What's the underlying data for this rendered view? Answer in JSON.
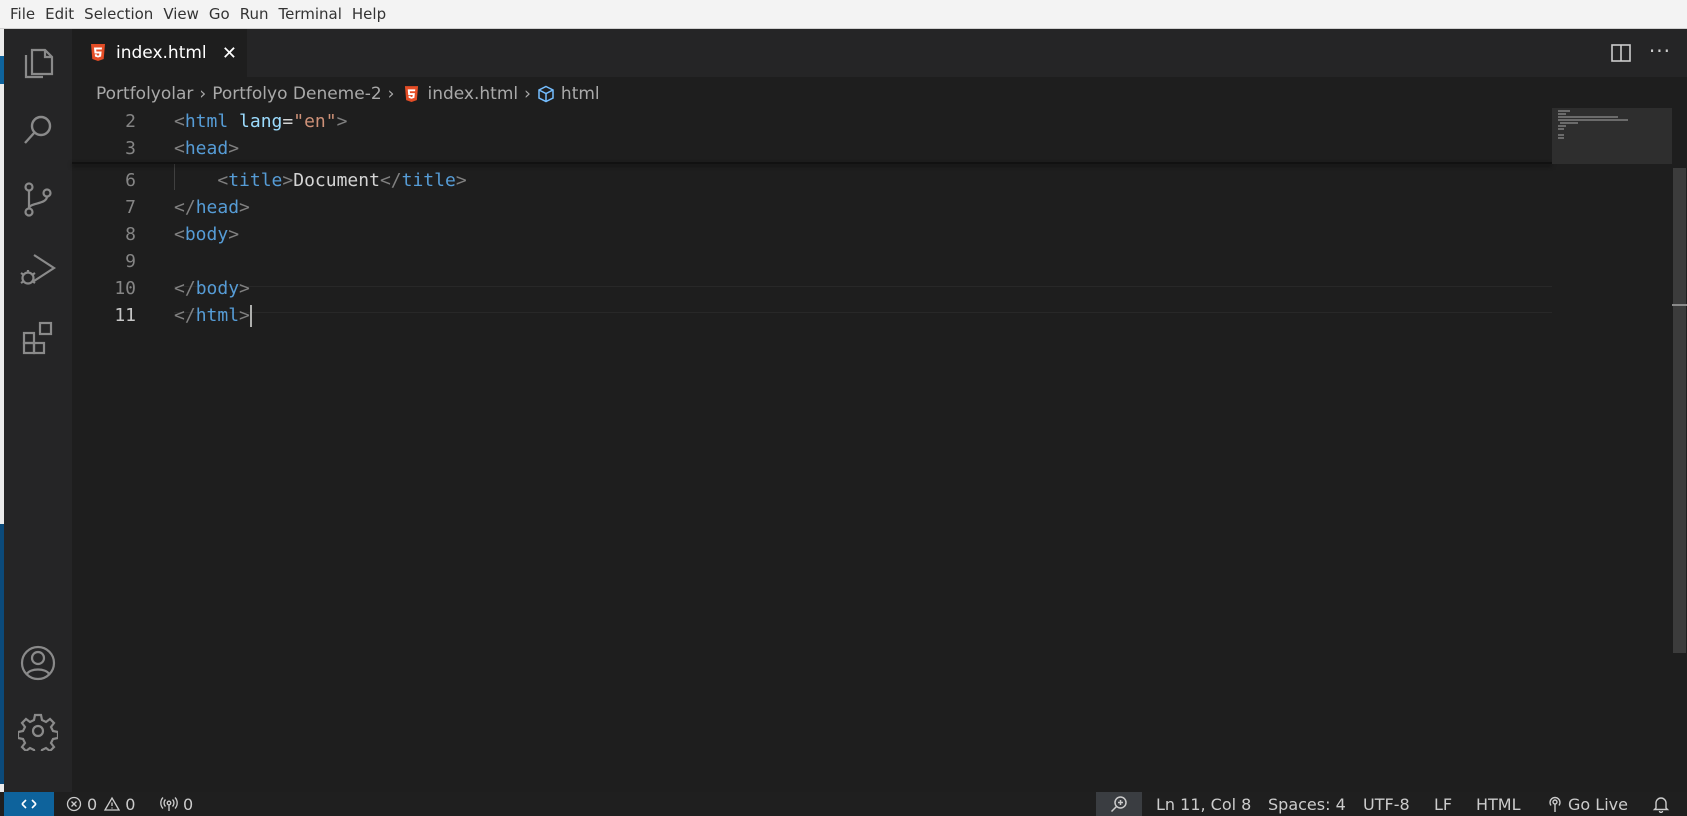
{
  "menu": [
    "File",
    "Edit",
    "Selection",
    "View",
    "Go",
    "Run",
    "Terminal",
    "Help"
  ],
  "activity_bar": [
    "explorer-icon",
    "search-icon",
    "source-control-icon",
    "run-debug-icon",
    "extensions-icon",
    "account-icon",
    "settings-gear-icon"
  ],
  "tab": {
    "label": "index.html",
    "close": "✕",
    "icon": "html5-icon"
  },
  "editor_actions": {
    "more": "···"
  },
  "breadcrumb": {
    "items": [
      "Portfolyolar",
      "Portfolyo Deneme-2",
      "index.html",
      "html"
    ],
    "separator": "›"
  },
  "editor": {
    "lines": [
      {
        "num": "2",
        "tokens": [
          [
            "<",
            "punc"
          ],
          [
            "html",
            "tag"
          ],
          [
            " ",
            "text"
          ],
          [
            "lang",
            "attr"
          ],
          [
            "=",
            "text"
          ],
          [
            "\"en\"",
            "str"
          ],
          [
            ">",
            "punc"
          ]
        ]
      },
      {
        "num": "3",
        "tokens": [
          [
            "<",
            "punc"
          ],
          [
            "head",
            "tag"
          ],
          [
            ">",
            "punc"
          ]
        ]
      },
      {
        "num": "6",
        "tokens": [
          [
            "    ",
            "text"
          ],
          [
            "<",
            "punc"
          ],
          [
            "title",
            "tag"
          ],
          [
            ">",
            "punc"
          ],
          [
            "Document",
            "text"
          ],
          [
            "</",
            "punc"
          ],
          [
            "title",
            "tag"
          ],
          [
            ">",
            "punc"
          ]
        ]
      },
      {
        "num": "7",
        "tokens": [
          [
            "</",
            "punc"
          ],
          [
            "head",
            "tag"
          ],
          [
            ">",
            "punc"
          ]
        ]
      },
      {
        "num": "8",
        "tokens": [
          [
            "<",
            "punc"
          ],
          [
            "body",
            "tag"
          ],
          [
            ">",
            "punc"
          ]
        ]
      },
      {
        "num": "9",
        "tokens": []
      },
      {
        "num": "10",
        "tokens": [
          [
            "</",
            "punc"
          ],
          [
            "body",
            "tag"
          ],
          [
            ">",
            "punc"
          ]
        ]
      },
      {
        "num": "11",
        "tokens": [
          [
            "</",
            "punc"
          ],
          [
            "html",
            "tag"
          ],
          [
            ">",
            "punc"
          ]
        ]
      }
    ],
    "active_line": "11"
  },
  "status": {
    "errors": "0",
    "warnings": "0",
    "ports": "0",
    "position": "Ln 11, Col 8",
    "spaces": "Spaces: 4",
    "encoding": "UTF-8",
    "eol": "LF",
    "language": "HTML",
    "live": "Go Live"
  },
  "colors": {
    "tag": "#569cd6",
    "attr": "#9cdcfe",
    "string": "#ce9178",
    "punctuation": "#808080",
    "html5": "#e44d26",
    "remote": "#0e639c"
  }
}
